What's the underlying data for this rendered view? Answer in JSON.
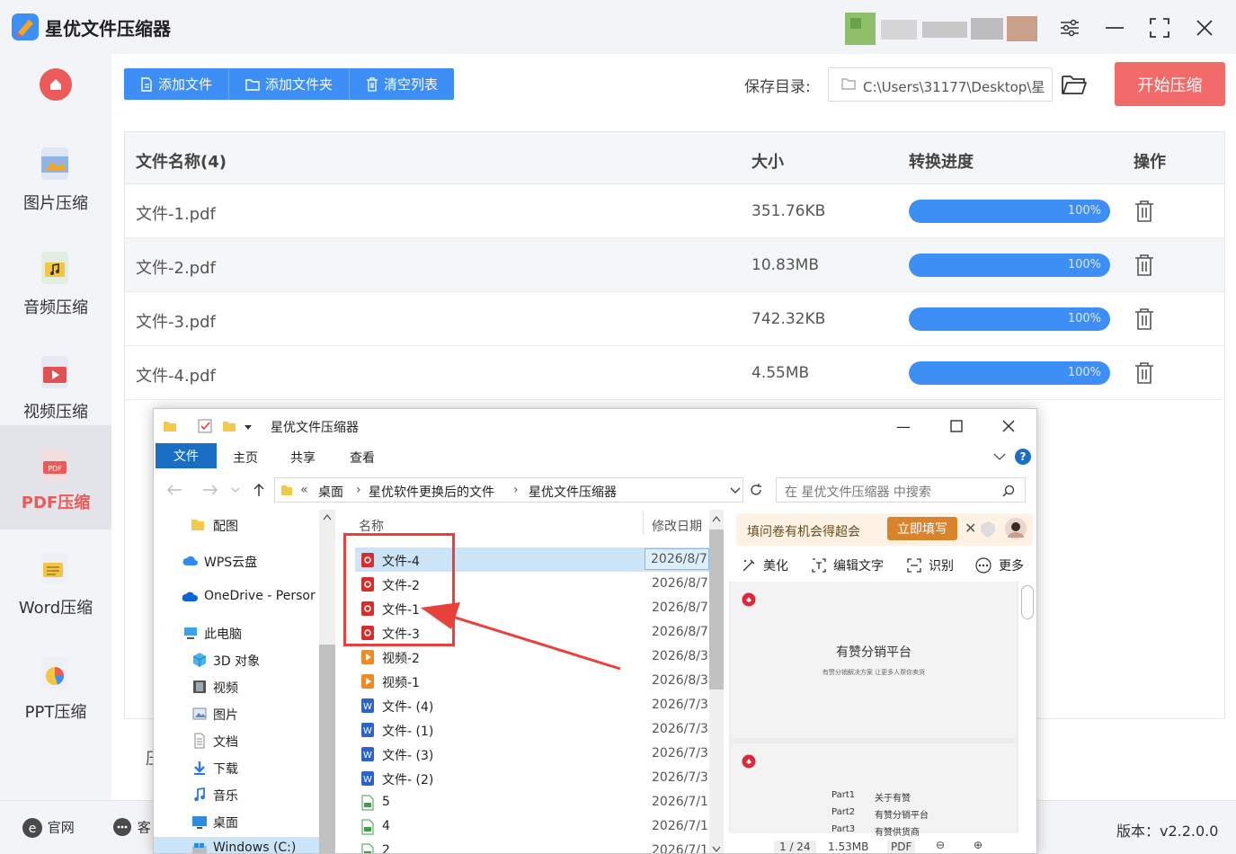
{
  "app": {
    "title": "星优文件压缩器",
    "accent": "#3d8ef5",
    "danger": "#f26b6b"
  },
  "sidebar": {
    "home_icon": "home-icon",
    "items": [
      {
        "label": "图片压缩",
        "icon": "image-icon"
      },
      {
        "label": "音频压缩",
        "icon": "music-icon"
      },
      {
        "label": "视频压缩",
        "icon": "video-icon"
      },
      {
        "label": "PDF压缩",
        "icon": "pdf-icon",
        "active": true
      },
      {
        "label": "Word压缩",
        "icon": "word-icon"
      },
      {
        "label": "PPT压缩",
        "icon": "ppt-icon"
      }
    ]
  },
  "toolbar": {
    "add_file": "添加文件",
    "add_folder": "添加文件夹",
    "clear_list": "清空列表",
    "save_label": "保存目录:",
    "save_path": "C:\\Users\\31177\\Desktop\\星",
    "start": "开始压缩"
  },
  "table": {
    "headers": {
      "name": "文件名称(4)",
      "size": "大小",
      "progress": "转换进度",
      "action": "操作"
    },
    "rows": [
      {
        "name": "文件-1.pdf",
        "size": "351.76KB",
        "progress": "100%",
        "progress_value": 1.0
      },
      {
        "name": "文件-2.pdf",
        "size": "10.83MB",
        "progress": "100%",
        "progress_value": 1.0
      },
      {
        "name": "文件-3.pdf",
        "size": "742.32KB",
        "progress": "100%",
        "progress_value": 1.0
      },
      {
        "name": "文件-4.pdf",
        "size": "4.55MB",
        "progress": "100%",
        "progress_value": 1.0
      }
    ]
  },
  "main_bottom_label": "压",
  "footer": {
    "website": "官网",
    "service": "客",
    "version": "版本：v2.2.0.0"
  },
  "explorer": {
    "title": "星优文件压缩器",
    "ribbon": {
      "file": "文件",
      "home": "主页",
      "share": "共享",
      "view": "查看"
    },
    "breadcrumbs": [
      "«",
      "桌面",
      "星优软件更换后的文件",
      "星优文件压缩器"
    ],
    "search_placeholder": "在 星优文件压缩器 中搜索",
    "nav": [
      {
        "label": "配图",
        "icon": "folder-icon"
      },
      {
        "label": "WPS云盘",
        "icon": "cloud-icon"
      },
      {
        "label": "OneDrive - Persor",
        "icon": "onedrive-icon"
      },
      {
        "label": "此电脑",
        "icon": "computer-icon"
      },
      {
        "label": "3D 对象",
        "icon": "cube-icon"
      },
      {
        "label": "视频",
        "icon": "film-icon"
      },
      {
        "label": "图片",
        "icon": "picture-icon"
      },
      {
        "label": "文档",
        "icon": "document-icon"
      },
      {
        "label": "下载",
        "icon": "download-icon"
      },
      {
        "label": "音乐",
        "icon": "music-note-icon"
      },
      {
        "label": "桌面",
        "icon": "desktop-icon"
      },
      {
        "label": "Windows (C:)",
        "icon": "drive-icon"
      }
    ],
    "columns": {
      "name": "名称",
      "date": "修改日期"
    },
    "files": [
      {
        "name": "文件-4",
        "date": "2026/8/7",
        "type": "pdf"
      },
      {
        "name": "文件-2",
        "date": "2026/8/7",
        "type": "pdf"
      },
      {
        "name": "文件-1",
        "date": "2026/8/7",
        "type": "pdf"
      },
      {
        "name": "文件-3",
        "date": "2026/8/7",
        "type": "pdf"
      },
      {
        "name": "视频-2",
        "date": "2026/8/3",
        "type": "video"
      },
      {
        "name": "视频-1",
        "date": "2026/8/3",
        "type": "video"
      },
      {
        "name": "文件- (4)",
        "date": "2026/7/3",
        "type": "word"
      },
      {
        "name": "文件- (1)",
        "date": "2026/7/3",
        "type": "word"
      },
      {
        "name": "文件- (3)",
        "date": "2026/7/3",
        "type": "word"
      },
      {
        "name": "文件- (2)",
        "date": "2026/7/3",
        "type": "word"
      },
      {
        "name": "5",
        "date": "2026/7/1",
        "type": "sheet"
      },
      {
        "name": "4",
        "date": "2026/7/1",
        "type": "sheet"
      },
      {
        "name": "2",
        "date": "2026/7/1",
        "type": "sheet"
      }
    ],
    "preview": {
      "promo_text": "填问卷有机会得超会",
      "promo_button": "立即填写",
      "tools": [
        "美化",
        "编辑文字",
        "识别",
        "更多"
      ],
      "page1_title": "有赞分销平台",
      "page1_sub": "有赞分销解决方案 让更多人帮你卖货",
      "page2_lines": [
        {
          "part": "Part1",
          "text": "关于有赞"
        },
        {
          "part": "Part2",
          "text": "有赞分销平台"
        },
        {
          "part": "Part3",
          "text": "有赞供货商"
        }
      ],
      "status": [
        "1 / 24",
        "1.53MB",
        "PDF"
      ]
    }
  }
}
